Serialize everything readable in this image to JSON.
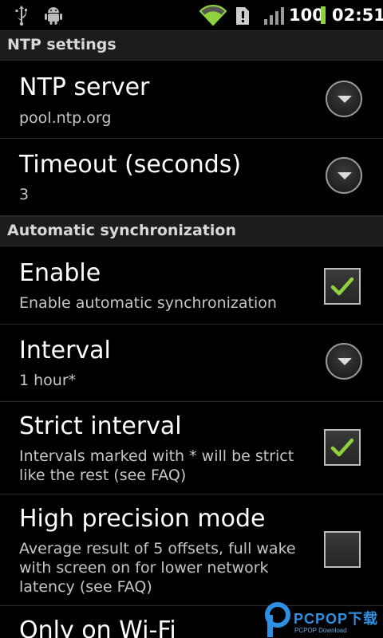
{
  "status_bar": {
    "icons": [
      "usb-icon",
      "android-debug-icon",
      "wifi-icon",
      "alert-icon",
      "signal-icon"
    ],
    "battery_text": "100",
    "time": "02:51",
    "battery_color": "#8fd13f"
  },
  "ntp_settings": {
    "header": "NTP settings",
    "server": {
      "title": "NTP server",
      "summary": "pool.ntp.org"
    },
    "timeout": {
      "title": "Timeout (seconds)",
      "summary": "3"
    }
  },
  "auto_sync": {
    "header": "Automatic synchronization",
    "enable": {
      "title": "Enable",
      "summary": "Enable automatic synchronization",
      "checked": true
    },
    "interval": {
      "title": "Interval",
      "summary": "1 hour*"
    },
    "strict_interval": {
      "title": "Strict interval",
      "summary": "Intervals marked with * will be strict like the rest (see FAQ)",
      "checked": true
    },
    "high_precision": {
      "title": "High precision mode",
      "summary": "Average result of 5 offsets, full wake with screen on for lower network latency (see FAQ)",
      "checked": false
    },
    "wifi_only": {
      "title": "Only on Wi-Fi"
    }
  },
  "watermark": {
    "text": "PCPOP下载",
    "subtext": "PCPOP Download"
  },
  "colors": {
    "check": "#8fd13f",
    "header_bg": "#1c1c1c",
    "summary": "#c6c6c6"
  }
}
